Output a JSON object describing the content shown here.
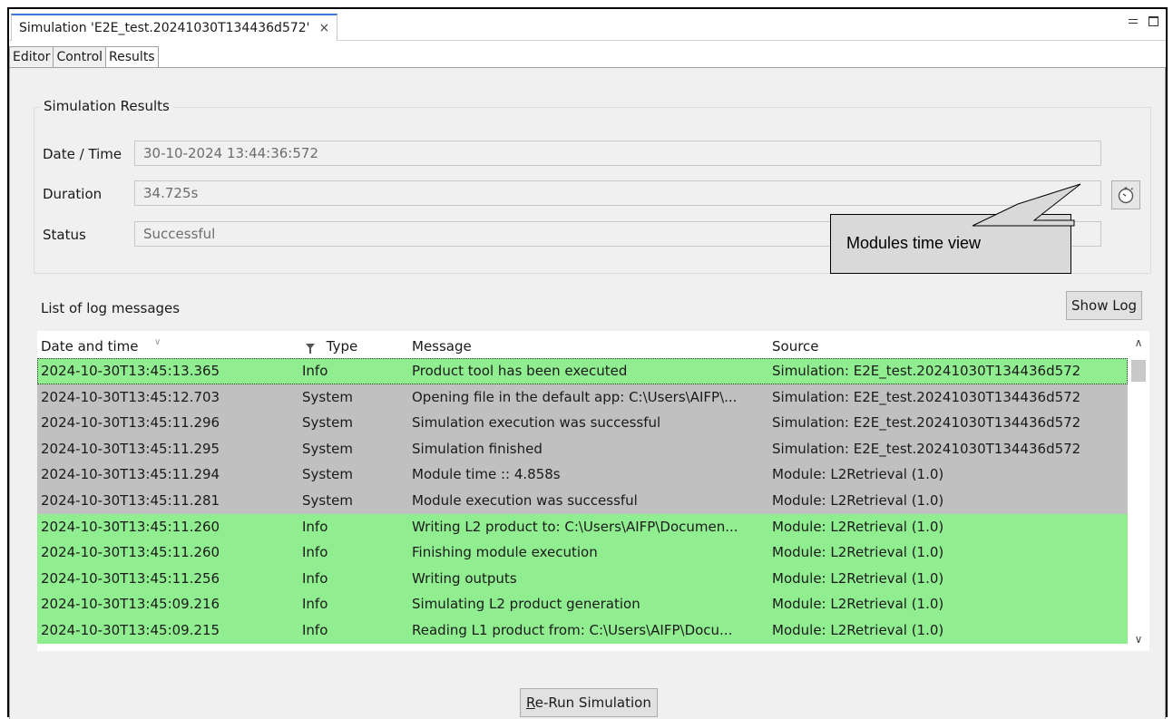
{
  "window": {
    "tab_title": "Simulation 'E2E_test.20241030T134436d572'",
    "close_glyph": "×"
  },
  "subtabs": [
    "Editor",
    "Control",
    "Results"
  ],
  "results": {
    "group_title": "Simulation Results",
    "date_time_label": "Date / Time",
    "date_time_value": "30-10-2024 13:44:36:572",
    "duration_label": "Duration",
    "duration_value": "34.725s",
    "status_label": "Status",
    "status_value": "Successful",
    "timer_button_icon": "stopwatch-icon"
  },
  "log": {
    "list_label": "List of log messages",
    "show_log_label": "Show Log",
    "columns": [
      "Date and time",
      "Type",
      "Message",
      "Source"
    ],
    "rows": [
      {
        "time": "2024-10-30T13:45:13.365",
        "type": "Info",
        "message": "Product tool has been executed",
        "source": "Simulation: E2E_test.20241030T134436d572"
      },
      {
        "time": "2024-10-30T13:45:12.703",
        "type": "System",
        "message": "Opening file in the default app: C:\\Users\\AIFP\\...",
        "source": "Simulation: E2E_test.20241030T134436d572"
      },
      {
        "time": "2024-10-30T13:45:11.296",
        "type": "System",
        "message": "Simulation execution was successful",
        "source": "Simulation: E2E_test.20241030T134436d572"
      },
      {
        "time": "2024-10-30T13:45:11.295",
        "type": "System",
        "message": "Simulation finished",
        "source": "Simulation: E2E_test.20241030T134436d572"
      },
      {
        "time": "2024-10-30T13:45:11.294",
        "type": "System",
        "message": "Module time :: 4.858s",
        "source": "Module: L2Retrieval (1.0)"
      },
      {
        "time": "2024-10-30T13:45:11.281",
        "type": "System",
        "message": "Module execution was successful",
        "source": "Module: L2Retrieval (1.0)"
      },
      {
        "time": "2024-10-30T13:45:11.260",
        "type": "Info",
        "message": "Writing L2 product to: C:\\Users\\AIFP\\Documen...",
        "source": "Module: L2Retrieval (1.0)"
      },
      {
        "time": "2024-10-30T13:45:11.260",
        "type": "Info",
        "message": "Finishing module execution",
        "source": "Module: L2Retrieval (1.0)"
      },
      {
        "time": "2024-10-30T13:45:11.256",
        "type": "Info",
        "message": "Writing outputs",
        "source": "Module: L2Retrieval (1.0)"
      },
      {
        "time": "2024-10-30T13:45:09.216",
        "type": "Info",
        "message": "Simulating L2 product generation",
        "source": "Module: L2Retrieval (1.0)"
      },
      {
        "time": "2024-10-30T13:45:09.215",
        "type": "Info",
        "message": "Reading L1 product from: C:\\Users\\AIFP\\Docu...",
        "source": "Module: L2Retrieval (1.0)"
      }
    ]
  },
  "rerun": {
    "mnemonic": "R",
    "rest": "e-Run Simulation"
  },
  "callout": {
    "text": "Modules time view"
  },
  "colors": {
    "info_row": "#90ee90",
    "system_row": "#c0c0c0",
    "tab_accent": "#3b7bd4"
  }
}
